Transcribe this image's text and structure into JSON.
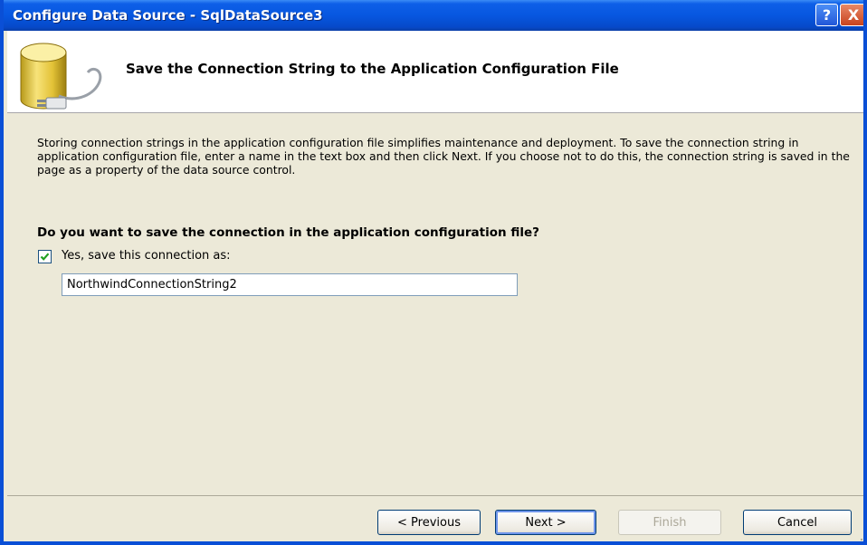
{
  "window": {
    "title": "Configure Data Source - SqlDataSource3",
    "help_glyph": "?",
    "close_glyph": "X"
  },
  "header": {
    "title": "Save the Connection String to the Application Configuration File",
    "icon": "database-connection-icon"
  },
  "main": {
    "description": "Storing connection strings in the application configuration file simplifies maintenance and deployment. To save the connection string in application configuration file, enter a name in the text box and then click Next. If you choose not to do this, the connection string is saved in the page as a property of the data source control.",
    "question": "Do you want to save the connection in the application configuration file?",
    "checkbox": {
      "label": "Yes, save this connection as:",
      "checked": true
    },
    "connection_name": {
      "value": "NorthwindConnectionString2"
    }
  },
  "footer": {
    "previous": "< Previous",
    "next": "Next >",
    "finish": "Finish",
    "cancel": "Cancel"
  },
  "colors": {
    "titlebar": "#0757e0",
    "dialog_bg": "#ece9d8",
    "check_mark": "#21a121"
  }
}
